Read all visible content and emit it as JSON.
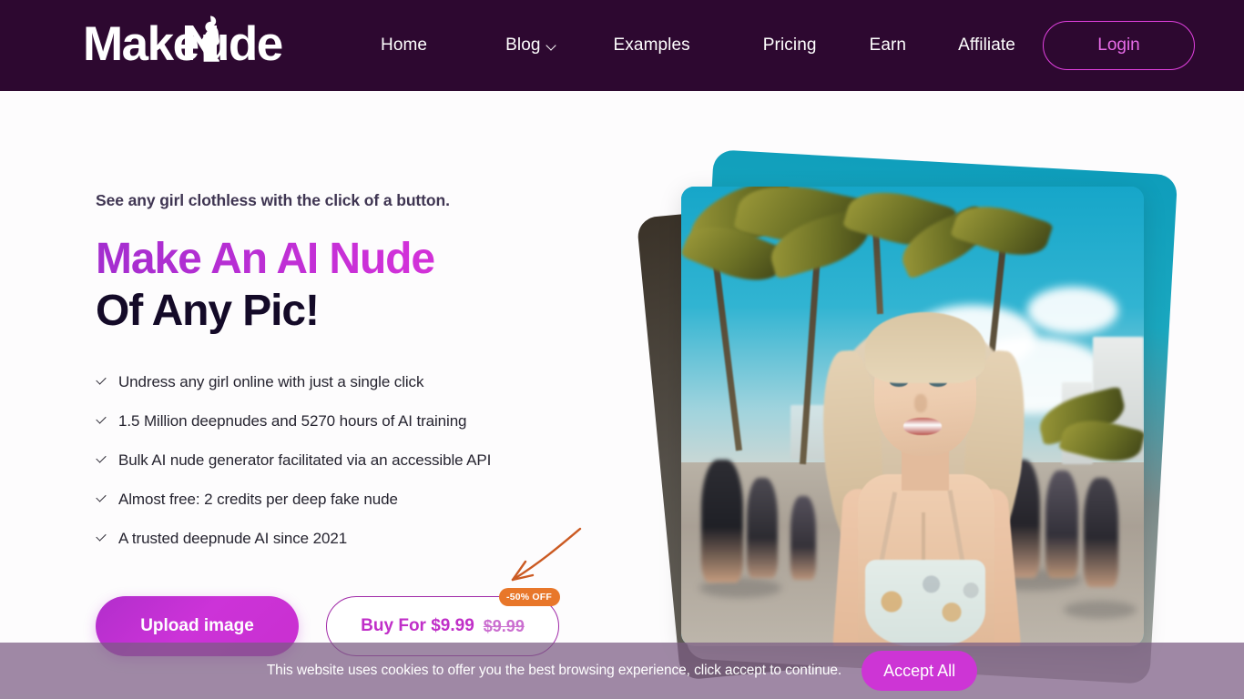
{
  "header": {
    "logo": {
      "text": "MakeNude",
      "icon": "female-silhouette-icon",
      "color": "#ffffff"
    },
    "background_color": "#2d0830",
    "nav": [
      {
        "label": "Home",
        "has_dropdown": false
      },
      {
        "label": "Blog",
        "has_dropdown": true,
        "dropdown_icon": "chevron-down-icon"
      },
      {
        "label": "Examples",
        "has_dropdown": false
      },
      {
        "label": "Pricing",
        "has_dropdown": false
      },
      {
        "label": "Earn",
        "has_dropdown": false
      },
      {
        "label": "Affiliate",
        "has_dropdown": false
      }
    ],
    "login_label": "Login",
    "login_color": "#e86ce8"
  },
  "hero": {
    "eyebrow": "See any girl clothless with the click of a button.",
    "headline_line1": "Make An AI Nude",
    "headline_line2": "Of Any Pic!",
    "headline_gradient_from": "#a32dcf",
    "headline_gradient_to": "#d62fd1",
    "headline_line2_color": "#140a28",
    "features": [
      "Undress any girl online with just a single click",
      "1.5 Million deepnudes and 5270 hours of AI training",
      "Bulk AI nude generator facilitated via an accessible API",
      "Almost free: 2 credits per deep fake nude",
      "A trusted deepnude AI since 2021"
    ],
    "upload_label": "Upload image",
    "buy_label": "Buy For $9.99",
    "buy_old_price": "$9.99",
    "discount_badge": "-50% OFF",
    "discount_badge_color": "#e8772a",
    "accent_color": "#cc33d8"
  },
  "cookie_banner": {
    "text": "This website uses cookies to offer you the best browsing experience, click accept to continue.",
    "accept_label": "Accept All",
    "accept_color": "#cd35d5"
  }
}
